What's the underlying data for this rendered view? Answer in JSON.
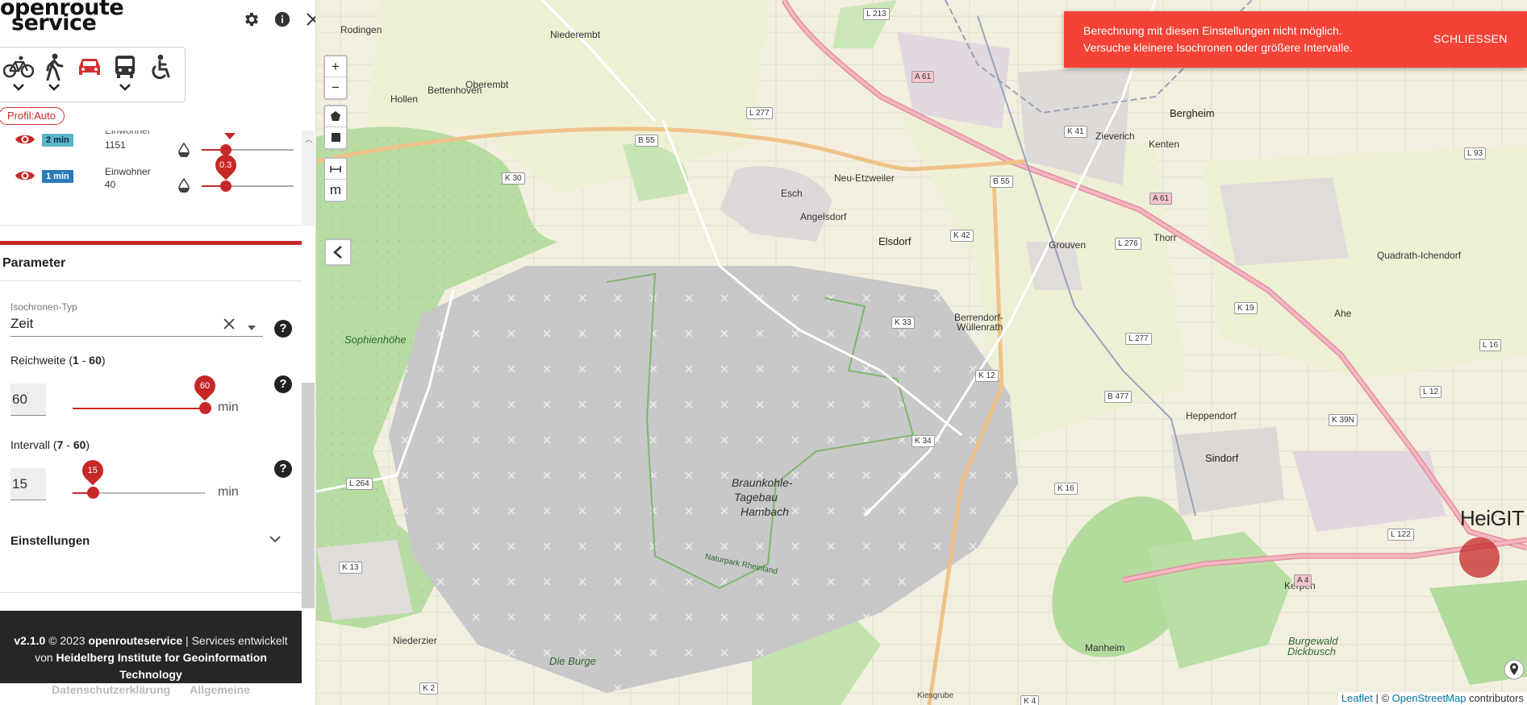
{
  "app": {
    "brand_line1": "openroute",
    "brand_line2": "service",
    "icons": [
      "gear-icon",
      "info-icon",
      "close-icon"
    ]
  },
  "profiles": {
    "items": [
      {
        "name": "cycling",
        "icon": "bicycle-icon",
        "has_dropdown": true
      },
      {
        "name": "walking",
        "icon": "pedestrian-icon",
        "has_dropdown": true
      },
      {
        "name": "car",
        "icon": "car-icon",
        "has_dropdown": false,
        "active": true
      },
      {
        "name": "bus",
        "icon": "bus-icon",
        "has_dropdown": true
      },
      {
        "name": "wheelchair",
        "icon": "wheelchair-icon",
        "has_dropdown": false
      }
    ],
    "chip": "Profil:Auto"
  },
  "isochrones": {
    "partial_label": "Einwohner",
    "rows": [
      {
        "badge": "2 min",
        "pop_label": "",
        "pop_value": "1151",
        "opacity": 0.3,
        "badge_style": "light"
      },
      {
        "badge": "1 min",
        "pop_label": "Einwohner",
        "pop_value": "40",
        "opacity": 0.3,
        "show_value": "0.3",
        "badge_style": "dark"
      }
    ]
  },
  "parameters": {
    "title": "Parameter",
    "type_label": "Isochronen-Typ",
    "type_value": "Zeit",
    "range_label_prefix": "Reichweite (",
    "range_min": "1",
    "range_sep": " - ",
    "range_max": "60",
    "range_label_suffix": ")",
    "range_value": "60",
    "range_slider": {
      "min": 1,
      "max": 60,
      "value": 60
    },
    "interval_label_prefix": "Intervall (",
    "interval_min": "7",
    "interval_max": "60",
    "interval_value": "15",
    "interval_slider": {
      "min": 7,
      "max": 60,
      "value": 15
    },
    "unit": "min",
    "help": "?",
    "settings_label": "Einstellungen"
  },
  "footer": {
    "version": "v2.1.0",
    "copyright": "© 2023",
    "org": "openrouteservice",
    "text1": "| Services entwickelt",
    "text2": "von",
    "institute_line1": "Heidelberg Institute for Geoinformation",
    "institute_line2": "Technology",
    "links": [
      "Datenschutzerklärung",
      "Allgemeine"
    ]
  },
  "map_controls": {
    "zoom_in": "+",
    "zoom_out": "−",
    "draw_polygon_icon": "pentagon-icon",
    "draw_rect_icon": "square-icon",
    "measure_icon": "measure-icon",
    "measure_unit": "m"
  },
  "toast": {
    "line1": "Berechnung mit diesen Einstellungen nicht möglich.",
    "line2": "Versuche kleinere Isochronen oder größere Intervalle.",
    "action": "SCHLIESSEN",
    "color": "#f44336"
  },
  "map": {
    "places": [
      {
        "label": "Rodingen",
        "cls": "town"
      },
      {
        "label": "Niederembt",
        "cls": "town"
      },
      {
        "label": "Oberembt",
        "cls": "town"
      },
      {
        "label": "Hollen",
        "cls": "town"
      },
      {
        "label": "Bettenhoven",
        "cls": "town"
      },
      {
        "label": "Bergheim",
        "cls": "city"
      },
      {
        "label": "Zieverich",
        "cls": "town"
      },
      {
        "label": "Kenten",
        "cls": "town"
      },
      {
        "label": "Neu-Etzweiler",
        "cls": "town"
      },
      {
        "label": "Esch",
        "cls": "town"
      },
      {
        "label": "Angelsdorf",
        "cls": "town"
      },
      {
        "label": "Elsdorf",
        "cls": "city"
      },
      {
        "label": "Grouven",
        "cls": "town"
      },
      {
        "label": "Thorr",
        "cls": "town"
      },
      {
        "label": "Quadrath-Ichendorf",
        "cls": "town"
      },
      {
        "label": "Sophienhöhe",
        "cls": "nature"
      },
      {
        "label": "Berrendorf-",
        "cls": "town"
      },
      {
        "label": "Wüllenrath",
        "cls": "town"
      },
      {
        "label": "Ahe",
        "cls": "town"
      },
      {
        "label": "Heppendorf",
        "cls": "town"
      },
      {
        "label": "Sindorf",
        "cls": "city"
      },
      {
        "label": "Braunkohle-",
        "cls": "mine"
      },
      {
        "label": "Tagebau",
        "cls": "mine"
      },
      {
        "label": "Hambach",
        "cls": "mine"
      },
      {
        "label": "Niederzier",
        "cls": "town"
      },
      {
        "label": "Die Burge",
        "cls": "nature"
      },
      {
        "label": "Manheim",
        "cls": "town"
      },
      {
        "label": "Kerpen",
        "cls": "town"
      },
      {
        "label": "Burgewald",
        "cls": "nature"
      },
      {
        "label": "Dickbusch",
        "cls": "nature"
      },
      {
        "label": "Kiesgrube",
        "cls": "small"
      },
      {
        "label": "Naturpark Rheinland",
        "cls": "green-small"
      }
    ],
    "roads": [
      "L 213",
      "A 61",
      "L 277",
      "B 55",
      "K 30",
      "B 55",
      "K 41",
      "A 61",
      "L 93",
      "K 42",
      "L 276",
      "K 33",
      "L 277",
      "K 12",
      "B 477",
      "K 19",
      "K 34",
      "K 16",
      "K 39N",
      "L 264",
      "K 13",
      "K 2",
      "K 4",
      "L 122",
      "A 4",
      "L 12",
      "L 16"
    ],
    "brand_overlay": "HeiGIT"
  },
  "attribution": {
    "leaflet": "Leaflet",
    "sep": " | © ",
    "osm": "OpenStreetMap",
    "contrib": " contributors"
  }
}
